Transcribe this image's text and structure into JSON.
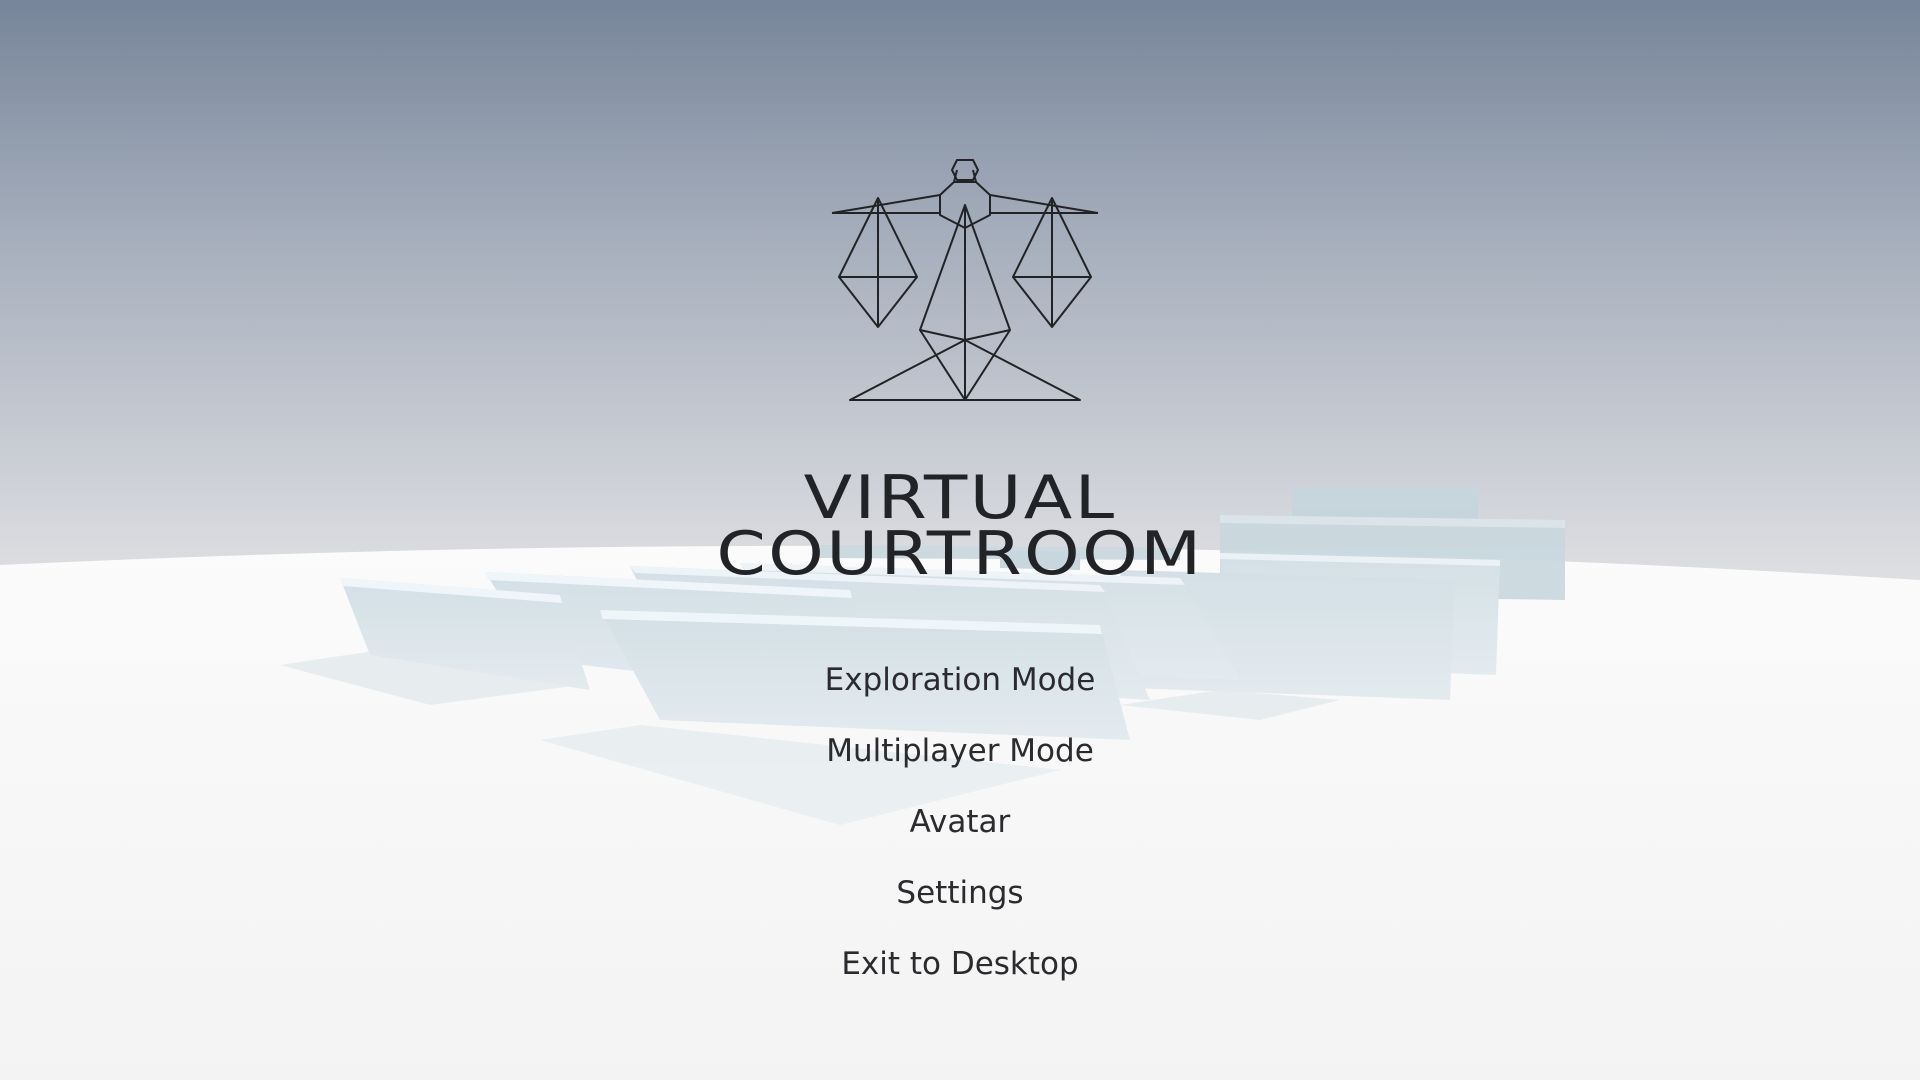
{
  "game": {
    "title_line1": "VIRTUAL",
    "title_line2": "COURTROOM",
    "logo_icon": "scales-of-justice-icon"
  },
  "menu": {
    "items": [
      {
        "id": "exploration",
        "label": "Exploration Mode"
      },
      {
        "id": "multiplayer",
        "label": "Multiplayer Mode"
      },
      {
        "id": "avatar",
        "label": "Avatar"
      },
      {
        "id": "settings",
        "label": "Settings"
      },
      {
        "id": "exit",
        "label": "Exit to Desktop"
      }
    ]
  },
  "colors": {
    "sky_top": "#77859a",
    "sky_bottom": "#dcdde0",
    "floor": "#f6f6f6",
    "bench": "#d3e0e6",
    "text": "#222327"
  }
}
